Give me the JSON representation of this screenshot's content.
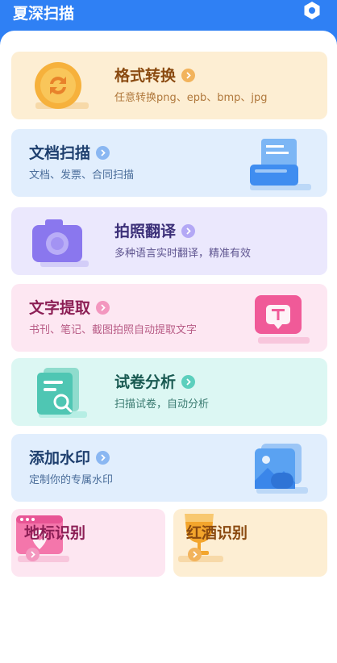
{
  "app": {
    "title": "夏深扫描"
  },
  "header": {
    "settings_icon": "hexagon-gear-icon"
  },
  "cards": [
    {
      "title": "格式转换",
      "subtitle": "任意转换png、epb、bmp、jpg",
      "icon": "refresh-coin-icon",
      "bg": "#fdeed3",
      "title_color": "#8a4a10",
      "sub_color": "#b0783c",
      "arrow_color": "#f2b35c"
    },
    {
      "title": "文档扫描",
      "subtitle": "文档、发票、合同扫描",
      "icon": "document-scanner-icon",
      "bg": "#e1eefd",
      "title_color": "#1e3f6e",
      "sub_color": "#4a6d9a",
      "arrow_color": "#8ab7f2"
    },
    {
      "title": "拍照翻译",
      "subtitle": "多种语言实时翻译，精准有效",
      "icon": "camera-icon",
      "bg": "#ebe8fd",
      "title_color": "#3b2f78",
      "sub_color": "#5e548f",
      "arrow_color": "#b3a8f5"
    },
    {
      "title": "文字提取",
      "subtitle": "书刊、笔记、截图拍照自动提取文字",
      "icon": "text-extract-icon",
      "bg": "#fde7f2",
      "title_color": "#8c1f55",
      "sub_color": "#b85c86",
      "arrow_color": "#f397bf"
    },
    {
      "title": "试卷分析",
      "subtitle": "扫描试卷，自动分析",
      "icon": "exam-search-icon",
      "bg": "#dcf7f3",
      "title_color": "#195a52",
      "sub_color": "#3b7b71",
      "arrow_color": "#5ccfbd"
    },
    {
      "title": "添加水印",
      "subtitle": "定制你的专属水印",
      "icon": "watermark-image-icon",
      "bg": "#e1eefd",
      "title_color": "#1e3f6e",
      "sub_color": "#4a6d9a",
      "arrow_color": "#8ab7f2"
    }
  ],
  "tiles": [
    {
      "title": "地标识别",
      "icon": "landmark-location-icon",
      "bg": "#fde6f1",
      "title_color": "#8c1f55",
      "arrow_color": "#f397bf"
    },
    {
      "title": "红酒识别",
      "icon": "wine-glass-icon",
      "bg": "#fdeed3",
      "title_color": "#8a4a10",
      "arrow_color": "#f2b35c"
    }
  ]
}
